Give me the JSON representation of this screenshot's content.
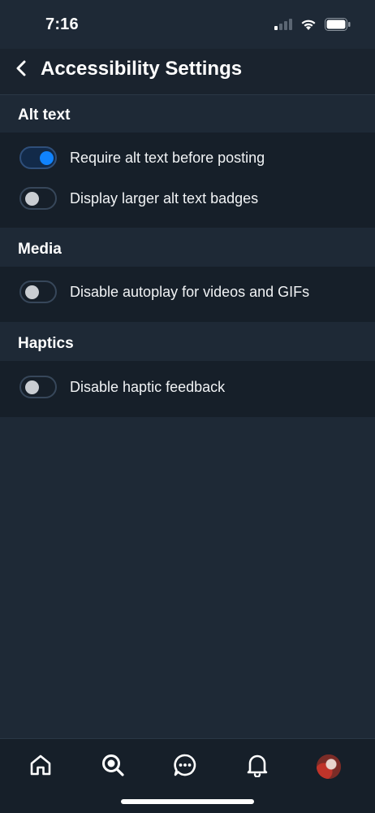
{
  "status_bar": {
    "time": "7:16",
    "icons": [
      "cellular-signal-icon",
      "wifi-icon",
      "battery-icon"
    ]
  },
  "header": {
    "back_icon": "chevron-left-icon",
    "title": "Accessibility Settings"
  },
  "sections": [
    {
      "heading": "Alt text",
      "items": [
        {
          "label": "Require alt text before posting",
          "enabled": true
        },
        {
          "label": "Display larger alt text badges",
          "enabled": false
        }
      ]
    },
    {
      "heading": "Media",
      "items": [
        {
          "label": "Disable autoplay for videos and GIFs",
          "enabled": false
        }
      ]
    },
    {
      "heading": "Haptics",
      "items": [
        {
          "label": "Disable haptic feedback",
          "enabled": false
        }
      ]
    }
  ],
  "bottom_nav": {
    "items": [
      "home-icon",
      "search-icon",
      "chat-icon",
      "bell-icon",
      "avatar"
    ]
  },
  "colors": {
    "accent": "#1083fe",
    "background": "#1e2936",
    "section_body": "#161f29"
  }
}
